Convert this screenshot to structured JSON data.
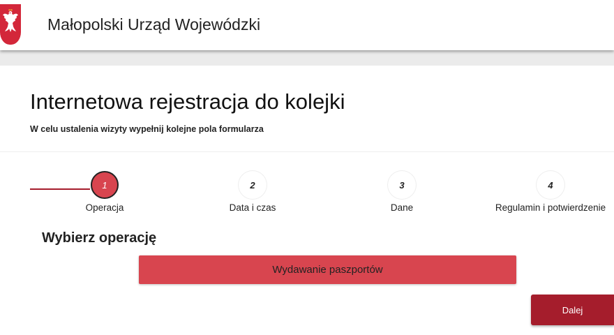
{
  "header": {
    "title": "Małopolski Urząd Wojewódzki",
    "emblem_icon": "polish-eagle-emblem-icon"
  },
  "main": {
    "title": "Internetowa rejestracja do kolejki",
    "subtitle": "W celu ustalenia wizyty wypełnij kolejne pola formularza"
  },
  "stepper": {
    "steps": [
      {
        "number": "1",
        "label": "Operacja",
        "active": true
      },
      {
        "number": "2",
        "label": "Data i czas",
        "active": false
      },
      {
        "number": "3",
        "label": "Dane",
        "active": false
      },
      {
        "number": "4",
        "label": "Regulamin i potwierdzenie",
        "active": false
      }
    ]
  },
  "operation": {
    "section_title": "Wybierz operację",
    "options": [
      "Wydawanie paszportów"
    ]
  },
  "actions": {
    "next_label": "Dalej"
  },
  "colors": {
    "primary": "#a51d2c",
    "accent": "#d8454f",
    "emblem_red": "#d3273a"
  }
}
